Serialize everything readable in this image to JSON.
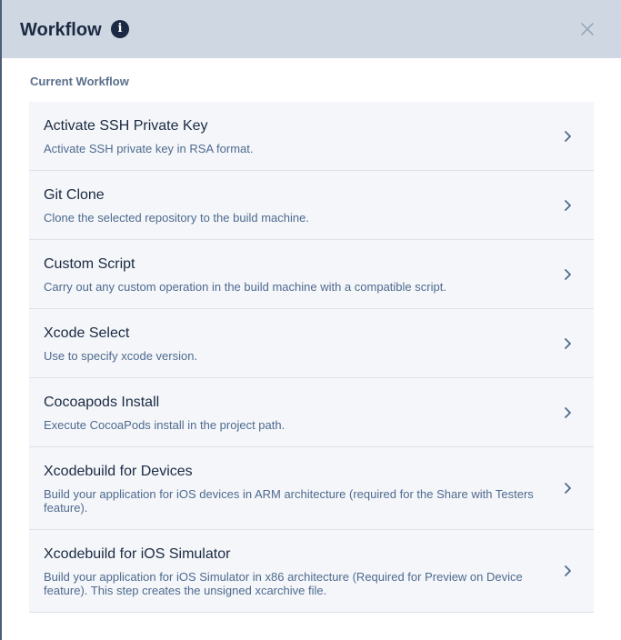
{
  "header": {
    "title": "Workflow",
    "info_icon": "i"
  },
  "section": {
    "label": "Current Workflow"
  },
  "steps": [
    {
      "title": "Activate SSH Private Key",
      "description": "Activate SSH private key in RSA format."
    },
    {
      "title": "Git Clone",
      "description": "Clone the selected repository to the build machine."
    },
    {
      "title": "Custom Script",
      "description": "Carry out any custom operation in the build machine with a compatible script."
    },
    {
      "title": "Xcode Select",
      "description": "Use to specify xcode version."
    },
    {
      "title": "Cocoapods Install",
      "description": "Execute CocoaPods install in the project path."
    },
    {
      "title": "Xcodebuild for Devices",
      "description": "Build your application for iOS devices in ARM architecture (required for the Share with Testers feature)."
    },
    {
      "title": "Xcodebuild for iOS Simulator",
      "description": "Build your application for iOS Simulator in x86 architecture (Required for Preview on Device feature). This step creates the unsigned xcarchive file."
    }
  ],
  "colors": {
    "header_bg": "#cfd7e2",
    "title": "#1b2a42",
    "description": "#4f6a8f",
    "item_bg": "#f4f6f9"
  }
}
